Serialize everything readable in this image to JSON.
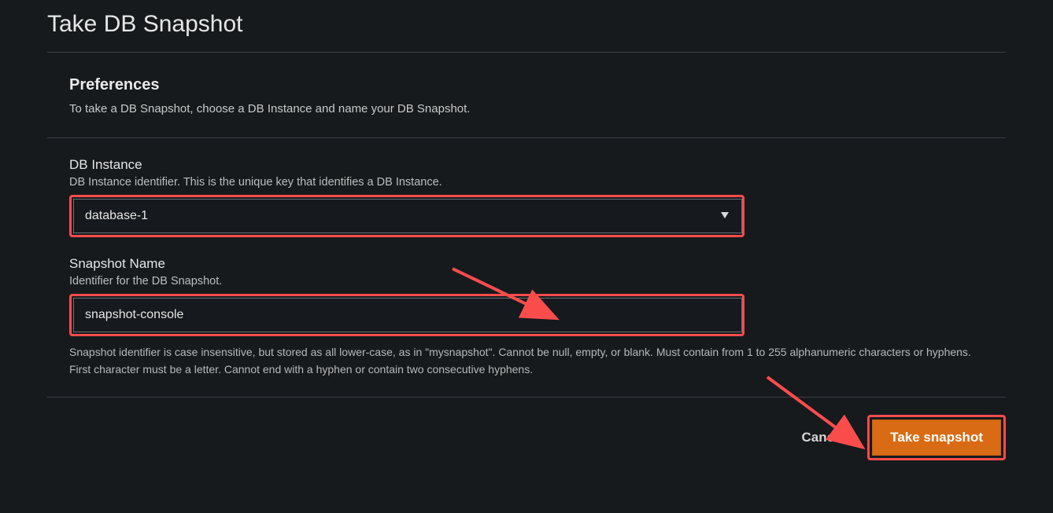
{
  "page": {
    "title": "Take DB Snapshot"
  },
  "preferences": {
    "heading": "Preferences",
    "description": "To take a DB Snapshot, choose a DB Instance and name your DB Snapshot."
  },
  "db_instance": {
    "label": "DB Instance",
    "sublabel": "DB Instance identifier. This is the unique key that identifies a DB Instance.",
    "value": "database-1"
  },
  "snapshot_name": {
    "label": "Snapshot Name",
    "sublabel": "Identifier for the DB Snapshot.",
    "value": "snapshot-console",
    "helper": "Snapshot identifier is case insensitive, but stored as all lower-case, as in \"mysnapshot\". Cannot be null, empty, or blank. Must contain from 1 to 255 alphanumeric characters or hyphens. First character must be a letter. Cannot end with a hyphen or contain two consecutive hyphens."
  },
  "footer": {
    "cancel_label": "Cancel",
    "primary_label": "Take snapshot"
  },
  "annotations": {
    "highlight_color": "#fb4c4c"
  }
}
